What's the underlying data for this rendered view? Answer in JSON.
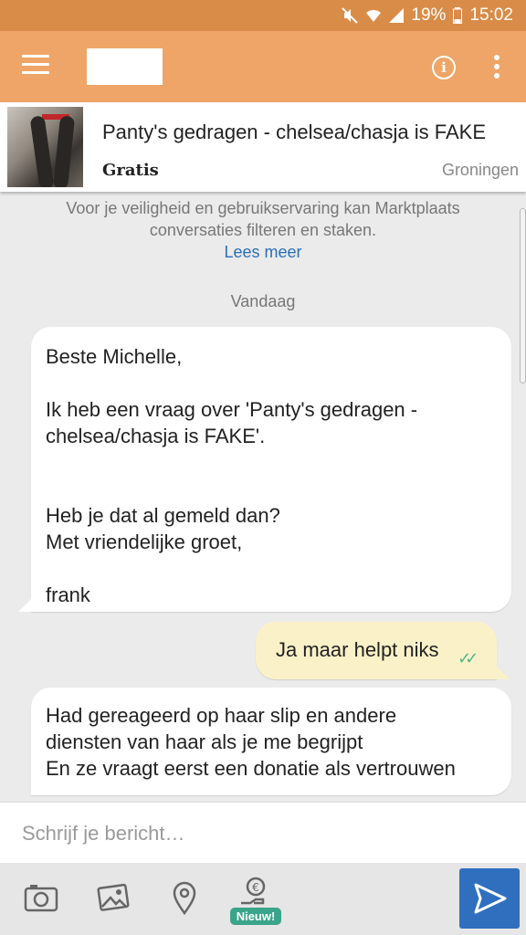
{
  "status_bar": {
    "battery": "19%",
    "time": "15:02"
  },
  "listing": {
    "title": "Panty's gedragen - chelsea/chasja is FAKE",
    "price": "Gratis",
    "location": "Groningen"
  },
  "notice": {
    "text": "Voor je veiligheid en gebruikservaring kan Marktplaats conversaties filteren en staken.",
    "link": "Lees meer"
  },
  "day_label": "Vandaag",
  "messages": [
    {
      "direction": "incoming",
      "text": "Beste Michelle,\n\nIk heb een vraag over 'Panty's gedragen - chelsea/chasja is FAKE'.\n\n\nHeb je dat al gemeld dan?\nMet vriendelijke groet,\n\nfrank"
    },
    {
      "direction": "outgoing",
      "text": "Ja maar helpt niks",
      "status": "read"
    },
    {
      "direction": "incoming",
      "text": "Had gereageerd  op haar slip en andere\ndiensten van haar als je me begrijpt\nEn ze vraagt eerst een donatie als vertrouwen"
    }
  ],
  "composer": {
    "placeholder": "Schrijf je bericht…"
  },
  "toolbar": {
    "payment_badge": "Nieuw!"
  },
  "colors": {
    "status_bar": "#d98c47",
    "app_bar": "#eea567",
    "outgoing_bubble": "#fbf1c9",
    "send_button": "#2f6fbe",
    "link": "#2a6eb5",
    "badge": "#3aa58a"
  },
  "icons": [
    "wifi-icon",
    "signal-icon",
    "mute-icon",
    "battery-icon",
    "menu-icon",
    "info-icon",
    "more-vert-icon",
    "camera-icon",
    "gallery-icon",
    "location-pin-icon",
    "payment-request-icon",
    "send-icon",
    "double-check-icon"
  ]
}
